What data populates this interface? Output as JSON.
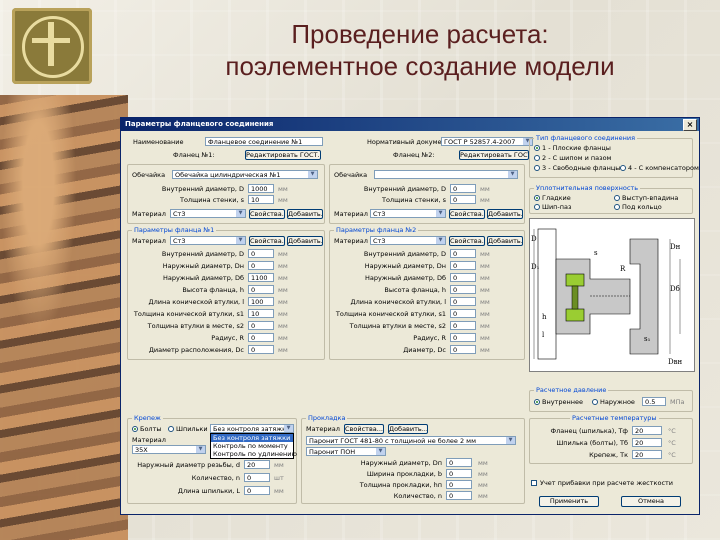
{
  "slide": {
    "title_line1": "Проведение расчета:",
    "title_line2": "поэлементное создание модели"
  },
  "dialog": {
    "title": "Параметры фланцевого соединения",
    "close_glyph": "×",
    "name_label": "Наименование",
    "name_value": "Фланцевое соединение №1",
    "standard_label": "Нормативный документ",
    "standard_value": "ГОСТ Р 52857.4-2007",
    "flange1_label": "Фланец №1:",
    "flange1_button": "Редактировать ГОСТ...",
    "flange2_label": "Фланец №2:",
    "flange2_button": "Редактировать ГОСТ...",
    "shell1_label": "Обечайка",
    "shell1_value": "Обечайка цилиндрическая №1",
    "shell2_label": "Обечайка",
    "upper": {
      "rows": [
        "Внутренний диаметр, D",
        "Толщина стенки, s"
      ],
      "values": [
        "1000",
        "10"
      ],
      "units": [
        "мм",
        "мм"
      ],
      "material_label": "Материал",
      "material_value": "Ст3",
      "props_button": "Свойства...",
      "add_button": "Добавить..."
    },
    "upper_right": {
      "rows": [
        "Внутренний диаметр, D",
        "Толщина стенки, s"
      ],
      "values": [
        "0",
        "0"
      ],
      "units": [
        "мм",
        "мм"
      ],
      "material_label": "Материал",
      "material_value": "Ст3",
      "props_button": "Свойства...",
      "add_button": "Добавить..."
    },
    "left_params": {
      "group_title": "Параметры фланца №1",
      "material_label": "Материал",
      "material_value": "Ст3",
      "props_button": "Свойства...",
      "add_button": "Добавить...",
      "rows": [
        "Внутренний диаметр, D",
        "Наружный диаметр, Dн",
        "Наружный диаметр, Dб",
        "Высота фланца, h",
        "Длина конической втулки, l",
        "Толщина конической втулки, s1",
        "Толщина втулки в месте, s2",
        "Радиус, R",
        "Диаметр расположения, Dс"
      ],
      "values": [
        "0",
        "0",
        "1100",
        "0",
        "100",
        "10",
        "0",
        "0",
        "0"
      ],
      "units": [
        "мм",
        "мм",
        "мм",
        "мм",
        "мм",
        "мм",
        "мм",
        "мм",
        "мм"
      ]
    },
    "right_params": {
      "group_title": "Параметры фланца №2",
      "material_label": "Материал",
      "material_value": "Ст3",
      "props_button": "Свойства...",
      "add_button": "Добавить...",
      "rows": [
        "Внутренний диаметр, D",
        "Наружный диаметр, Dн",
        "Наружный диаметр, Dб",
        "Высота фланца, h",
        "Длина конической втулки, l",
        "Толщина конической втулки, s1",
        "Толщина втулки в месте, s2",
        "Радиус, R",
        "Диаметр, Dс"
      ],
      "values": [
        "0",
        "0",
        "0",
        "0",
        "0",
        "0",
        "0",
        "0",
        "0"
      ],
      "units": [
        "мм",
        "мм",
        "мм",
        "мм",
        "мм",
        "мм",
        "мм",
        "мм",
        "мм"
      ]
    },
    "conn_type": {
      "title": "Тип фланцевого соединения",
      "options": [
        "1 - Плоские фланцы",
        "2 - С шипом и пазом",
        "3 - Свободные фланцы",
        "4 - С компенсатором"
      ]
    },
    "seal_surface": {
      "title": "Уплотнительная поверхность",
      "options": [
        "Гладкие",
        "Шип-паз",
        "Выступ-впадина",
        "Под кольцо"
      ]
    },
    "diagram_labels": [
      "D",
      "D₁",
      "Dн",
      "Dб",
      "s",
      "h",
      "l",
      "R",
      "s₁",
      "Dвн"
    ],
    "liner": {
      "title": "Расчетное давление",
      "radio1": "Внутреннее",
      "radio2": "Наружное",
      "value": "0.5",
      "unit": "МПа"
    },
    "temps": {
      "title": "Расчетные температуры",
      "rows": [
        "Фланец (шпилька), Тф",
        "Шпилька (болты), Тб",
        "Крепеж, Тк"
      ],
      "values": [
        "20",
        "20",
        "20"
      ],
      "units": [
        "°С",
        "°С",
        "°С"
      ]
    },
    "fastener": {
      "title": "Крепеж",
      "radio1": "Болты",
      "radio2": "Шпильки",
      "combo_value": "Без контроля затяжки",
      "dropdown": [
        "Без контроля затяжки",
        "Контроль по моменту",
        "Контроль по удлинению"
      ],
      "material_label": "Материал",
      "material_value": "35Х",
      "rows": [
        "Наружный диаметр резьбы, d",
        "Количество, n",
        "Длина шпильки, L"
      ],
      "values": [
        "20",
        "0",
        "0"
      ],
      "units": [
        "мм",
        "шт",
        "мм"
      ]
    },
    "gasket": {
      "title": "Прокладка",
      "material_label": "Материал",
      "props_button": "Свойства...",
      "add_button": "Добавить...",
      "value": "Паронит ГОСТ 481-80 с толщиной не более 2 мм",
      "combo2": "Паронит ПОН",
      "rows": [
        "Наружный диаметр, Dп",
        "Ширина прокладки, b",
        "Толщина прокладки, hп",
        "Количество, n"
      ],
      "values": [
        "0",
        "0",
        "0",
        "0"
      ],
      "units": [
        "мм",
        "мм",
        "мм",
        "мм"
      ]
    },
    "checkbox_label": "Учет прибавки при расчете жесткости",
    "ok_button": "Применить",
    "cancel_button": "Отмена"
  }
}
